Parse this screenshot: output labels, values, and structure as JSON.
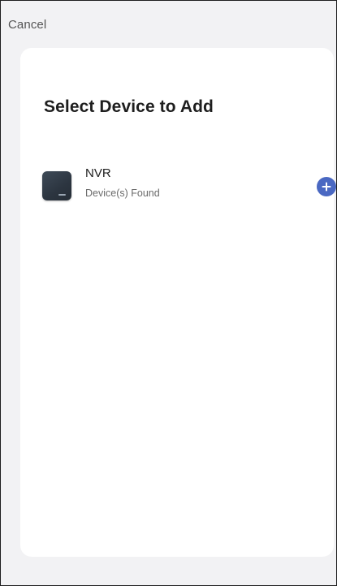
{
  "header": {
    "cancel_label": "Cancel"
  },
  "main": {
    "title": "Select Device to Add",
    "devices": [
      {
        "name": "NVR",
        "status": "Device(s) Found",
        "icon": "nvr-device-icon",
        "action_icon": "plus-circle-icon"
      }
    ]
  },
  "colors": {
    "accent": "#4a68c2",
    "background": "#f2f2f4",
    "card": "#ffffff"
  }
}
